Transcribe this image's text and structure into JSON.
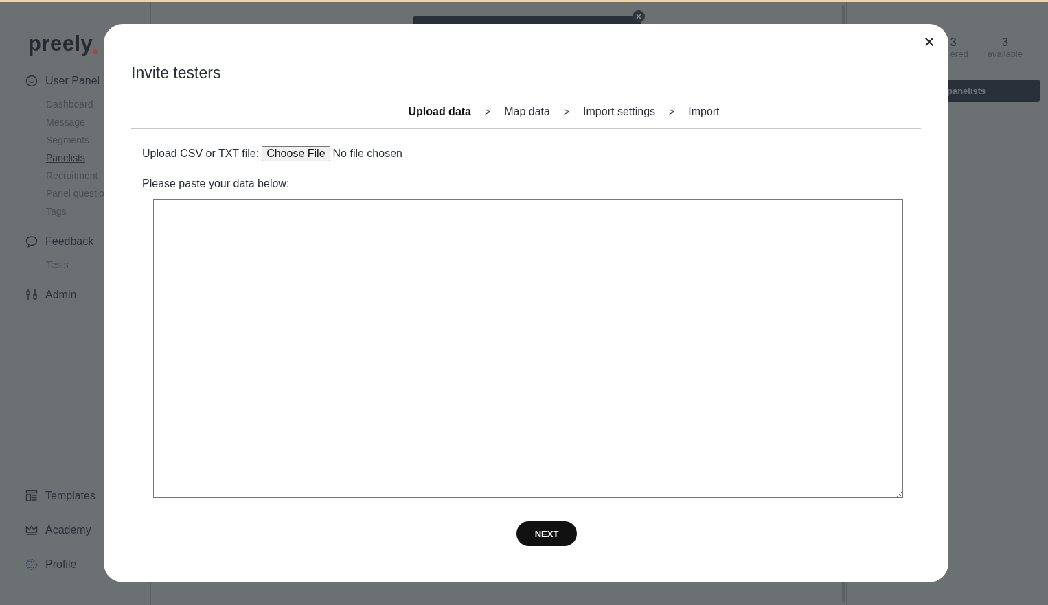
{
  "sidebar": {
    "logo": "preely",
    "sections": [
      {
        "label": "User Panel",
        "items": [
          {
            "label": "Dashboard",
            "selected": false
          },
          {
            "label": "Message",
            "selected": false
          },
          {
            "label": "Segments",
            "selected": false
          },
          {
            "label": "Panelists",
            "selected": true
          },
          {
            "label": "Recruitment",
            "selected": false
          },
          {
            "label": "Panel questio",
            "selected": false
          },
          {
            "label": "Tags",
            "selected": false
          }
        ]
      },
      {
        "label": "Feedback",
        "items": [
          {
            "label": "Tests",
            "selected": false
          }
        ]
      },
      {
        "label": "Admin"
      }
    ],
    "bottom": [
      {
        "label": "Templates"
      },
      {
        "label": "Academy"
      },
      {
        "label": "Profile"
      }
    ]
  },
  "right_panel": {
    "stats": [
      {
        "value": "3",
        "label": "ered"
      },
      {
        "value": "3",
        "label": "available"
      }
    ],
    "button": "panelists"
  },
  "modal": {
    "title": "Invite testers",
    "steps": [
      {
        "label": "Upload data",
        "selected": true
      },
      {
        "label": "Map data",
        "selected": false
      },
      {
        "label": "Import settings",
        "selected": false
      },
      {
        "label": "Import",
        "selected": false
      }
    ],
    "separators": [
      ">",
      ">",
      ">"
    ],
    "upload_label": "Upload CSV or TXT file:",
    "choose_button": "Choose File",
    "file_status": "No file chosen",
    "paste_label": "Please paste your data below:",
    "next_button": "NEXT"
  }
}
